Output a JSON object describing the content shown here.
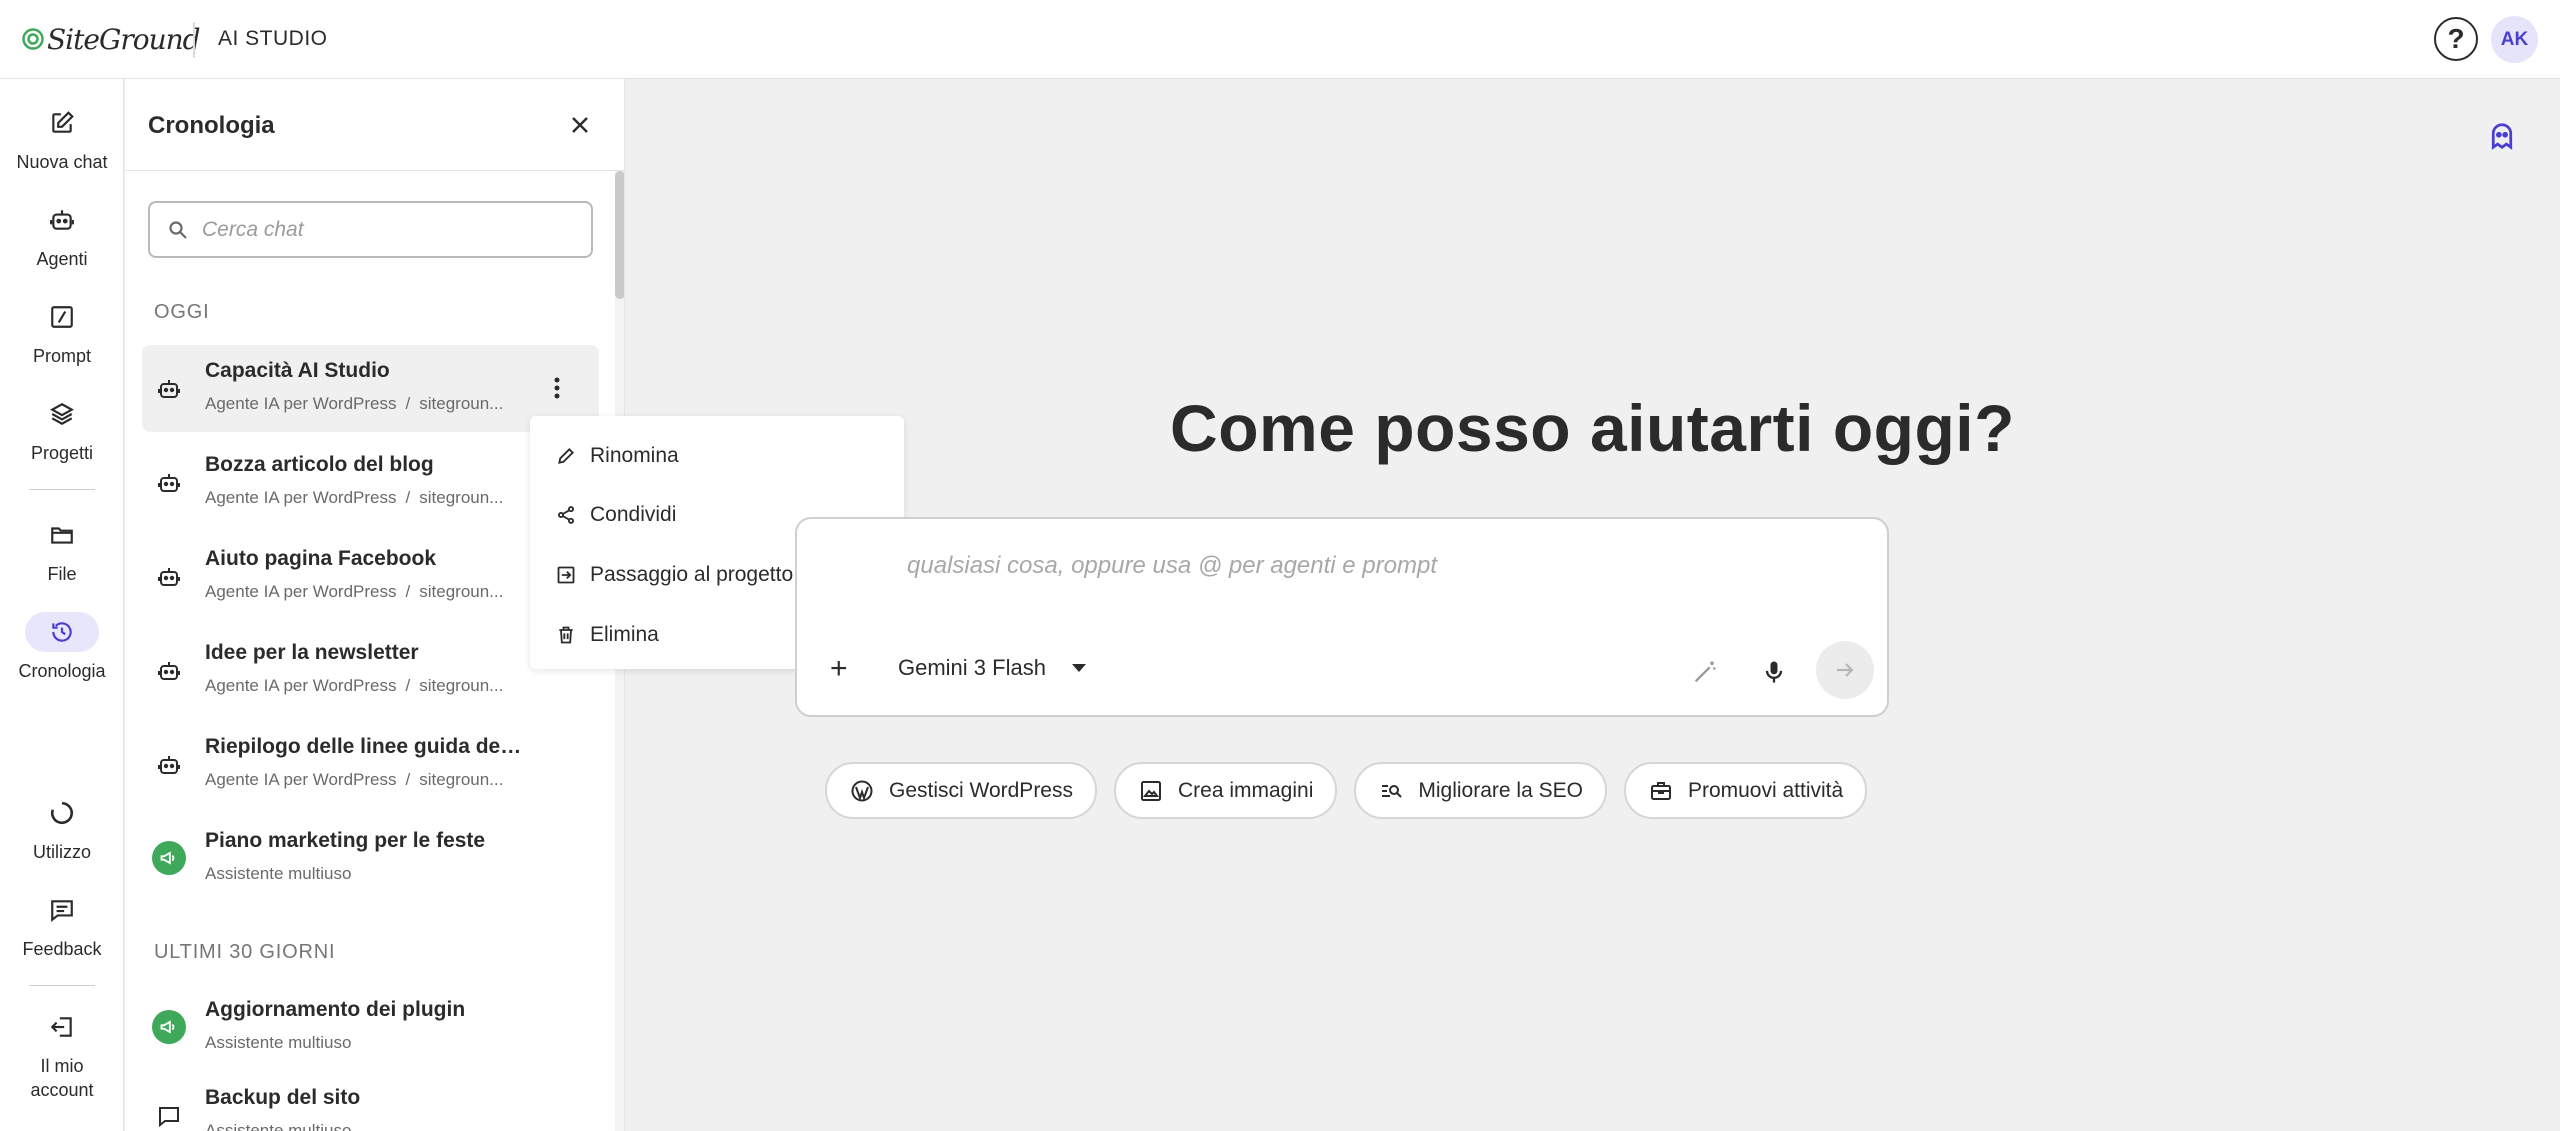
{
  "colors": {
    "accent": "#4a3fd0",
    "accent_bg": "#e8e6fb",
    "green": "#3fa85a",
    "text": "#2b2b2b"
  },
  "header": {
    "logo_text": "SiteGround",
    "app_title": "AI STUDIO",
    "help_icon": "question-icon",
    "avatar_initials": "AK"
  },
  "nav": {
    "new_chat": "Nuova chat",
    "agents": "Agenti",
    "prompt": "Prompt",
    "projects": "Progetti",
    "files": "File",
    "history": "Cronologia",
    "usage": "Utilizzo",
    "feedback": "Feedback",
    "account": "Il mio account"
  },
  "history": {
    "title": "Cronologia",
    "search_placeholder": "Cerca chat",
    "section_today": "OGGI",
    "section_30_days": "ULTIMI 30 GIORNI",
    "today_items": [
      {
        "title": "Capacità AI Studio",
        "agent": "Agente IA per WordPress",
        "site": "sitegroun...",
        "icon": "robot-icon"
      },
      {
        "title": "Bozza articolo del blog",
        "agent": "Agente IA per WordPress",
        "site": "sitegroun...",
        "icon": "robot-icon"
      },
      {
        "title": "Aiuto pagina Facebook",
        "agent": "Agente IA per WordPress",
        "site": "sitegroun...",
        "icon": "robot-icon"
      },
      {
        "title": "Idee per la newsletter",
        "agent": "Agente IA per WordPress",
        "site": "sitegroun...",
        "icon": "robot-icon"
      },
      {
        "title": "Riepilogo delle linee guida del b...",
        "agent": "Agente IA per WordPress",
        "site": "sitegroun...",
        "icon": "robot-icon"
      },
      {
        "title": "Piano marketing per le feste",
        "agent": "Assistente multiuso",
        "icon": "megaphone-icon"
      }
    ],
    "older_items": [
      {
        "title": "Aggiornamento dei plugin",
        "agent": "Assistente multiuso",
        "icon": "megaphone-icon"
      },
      {
        "title": "Backup del sito",
        "agent": "Assistente multiuso",
        "icon": "chat-bubble-icon"
      }
    ],
    "separator": "/"
  },
  "context_menu": {
    "rename": "Rinomina",
    "share": "Condividi",
    "move_to_project": "Passaggio al progetto",
    "delete": "Elimina"
  },
  "main": {
    "heading": "Come posso aiutarti oggi?",
    "prompt_placeholder": "qualsiasi cosa, oppure usa @ per agenti e prompt",
    "model": "Gemini 3 Flash",
    "chips": {
      "wordpress": "Gestisci WordPress",
      "images": "Crea immagini",
      "seo": "Migliorare la SEO",
      "promote": "Promuovi attività"
    }
  }
}
